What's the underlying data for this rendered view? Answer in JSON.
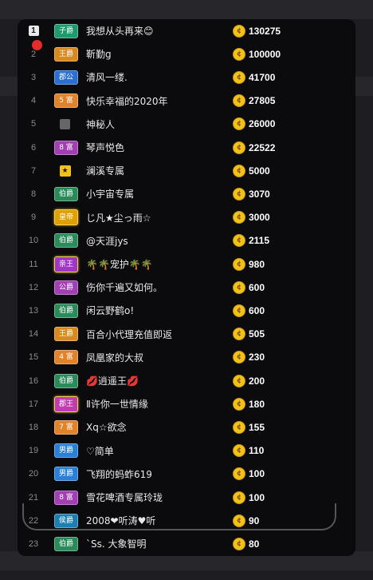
{
  "colors": {
    "子爵": "#1f9a6f",
    "王爵": "#d88a1e",
    "郡公": "#2b6fd3",
    "富": "#e0832a",
    "伯爵": "#2a8a5a",
    "皇帝": "#e0a000",
    "亲王": "#9f37c4",
    "公爵": "#a23fb2",
    "男爵": "#2a7fd8",
    "郡王": "#c03cb0",
    "侯爵": "#1d7fb0"
  },
  "rows": [
    {
      "rank": "1",
      "badge": "子爵",
      "badge_type": "子爵",
      "name": "我想从头再来😊",
      "score": "130275"
    },
    {
      "rank": "2",
      "badge": "王爵",
      "badge_type": "王爵",
      "name": "靳勤g",
      "score": "100000"
    },
    {
      "rank": "3",
      "badge": "郡公",
      "badge_type": "郡公",
      "name": "清风一缕.",
      "score": "41700"
    },
    {
      "rank": "4",
      "badge": "5 富",
      "badge_type": "富",
      "name": "快乐幸福的2020年",
      "score": "27805"
    },
    {
      "rank": "5",
      "badge": "",
      "badge_type": "anon",
      "name": "神秘人",
      "score": "26000"
    },
    {
      "rank": "6",
      "badge": "8 富",
      "badge_type": "公爵",
      "name": "琴声悦色",
      "score": "22522"
    },
    {
      "rank": "7",
      "badge": "",
      "badge_type": "star",
      "name": "澜溪专属",
      "score": "5000"
    },
    {
      "rank": "8",
      "badge": "伯爵",
      "badge_type": "伯爵",
      "name": "小宇宙专属",
      "score": "3070"
    },
    {
      "rank": "9",
      "badge": "皇帝",
      "badge_type": "皇帝",
      "name": "じ凡★尘っ雨☆",
      "score": "3000"
    },
    {
      "rank": "10",
      "badge": "伯爵",
      "badge_type": "伯爵",
      "name": "@天涯jys",
      "score": "2115"
    },
    {
      "rank": "11",
      "badge": "亲王",
      "badge_type": "亲王",
      "name": "🌴🌴宠护🌴🌴",
      "score": "980"
    },
    {
      "rank": "12",
      "badge": "公爵",
      "badge_type": "公爵",
      "name": "伤你千遍又如何。",
      "score": "600"
    },
    {
      "rank": "13",
      "badge": "伯爵",
      "badge_type": "伯爵",
      "name": "闲云野鹤o!",
      "score": "600"
    },
    {
      "rank": "14",
      "badge": "王爵",
      "badge_type": "王爵",
      "name": "百合小代理充值即返",
      "score": "505"
    },
    {
      "rank": "15",
      "badge": "4 富",
      "badge_type": "富",
      "name": "凤凰家的大叔",
      "score": "230"
    },
    {
      "rank": "16",
      "badge": "伯爵",
      "badge_type": "伯爵",
      "name": "💋逍遥王💋",
      "score": "200"
    },
    {
      "rank": "17",
      "badge": "郡王",
      "badge_type": "郡王",
      "name": "Ⅱ许你一世情缘",
      "score": "180"
    },
    {
      "rank": "18",
      "badge": "7 富",
      "badge_type": "富",
      "name": "Xq☆欲念",
      "score": "155"
    },
    {
      "rank": "19",
      "badge": "男爵",
      "badge_type": "男爵",
      "name": "♡简单",
      "score": "110"
    },
    {
      "rank": "20",
      "badge": "男爵",
      "badge_type": "男爵",
      "name": "飞翔的蚂蚱619",
      "score": "100"
    },
    {
      "rank": "21",
      "badge": "8 富",
      "badge_type": "公爵",
      "name": "雪花啤酒专属玲珑",
      "score": "100"
    },
    {
      "rank": "22",
      "badge": "侯爵",
      "badge_type": "侯爵",
      "name": "2008❤听涛♥听",
      "score": "90"
    },
    {
      "rank": "23",
      "badge": "伯爵",
      "badge_type": "伯爵",
      "name": "`Ss. 大象智明",
      "score": "80"
    }
  ],
  "coin_symbol": "¢"
}
